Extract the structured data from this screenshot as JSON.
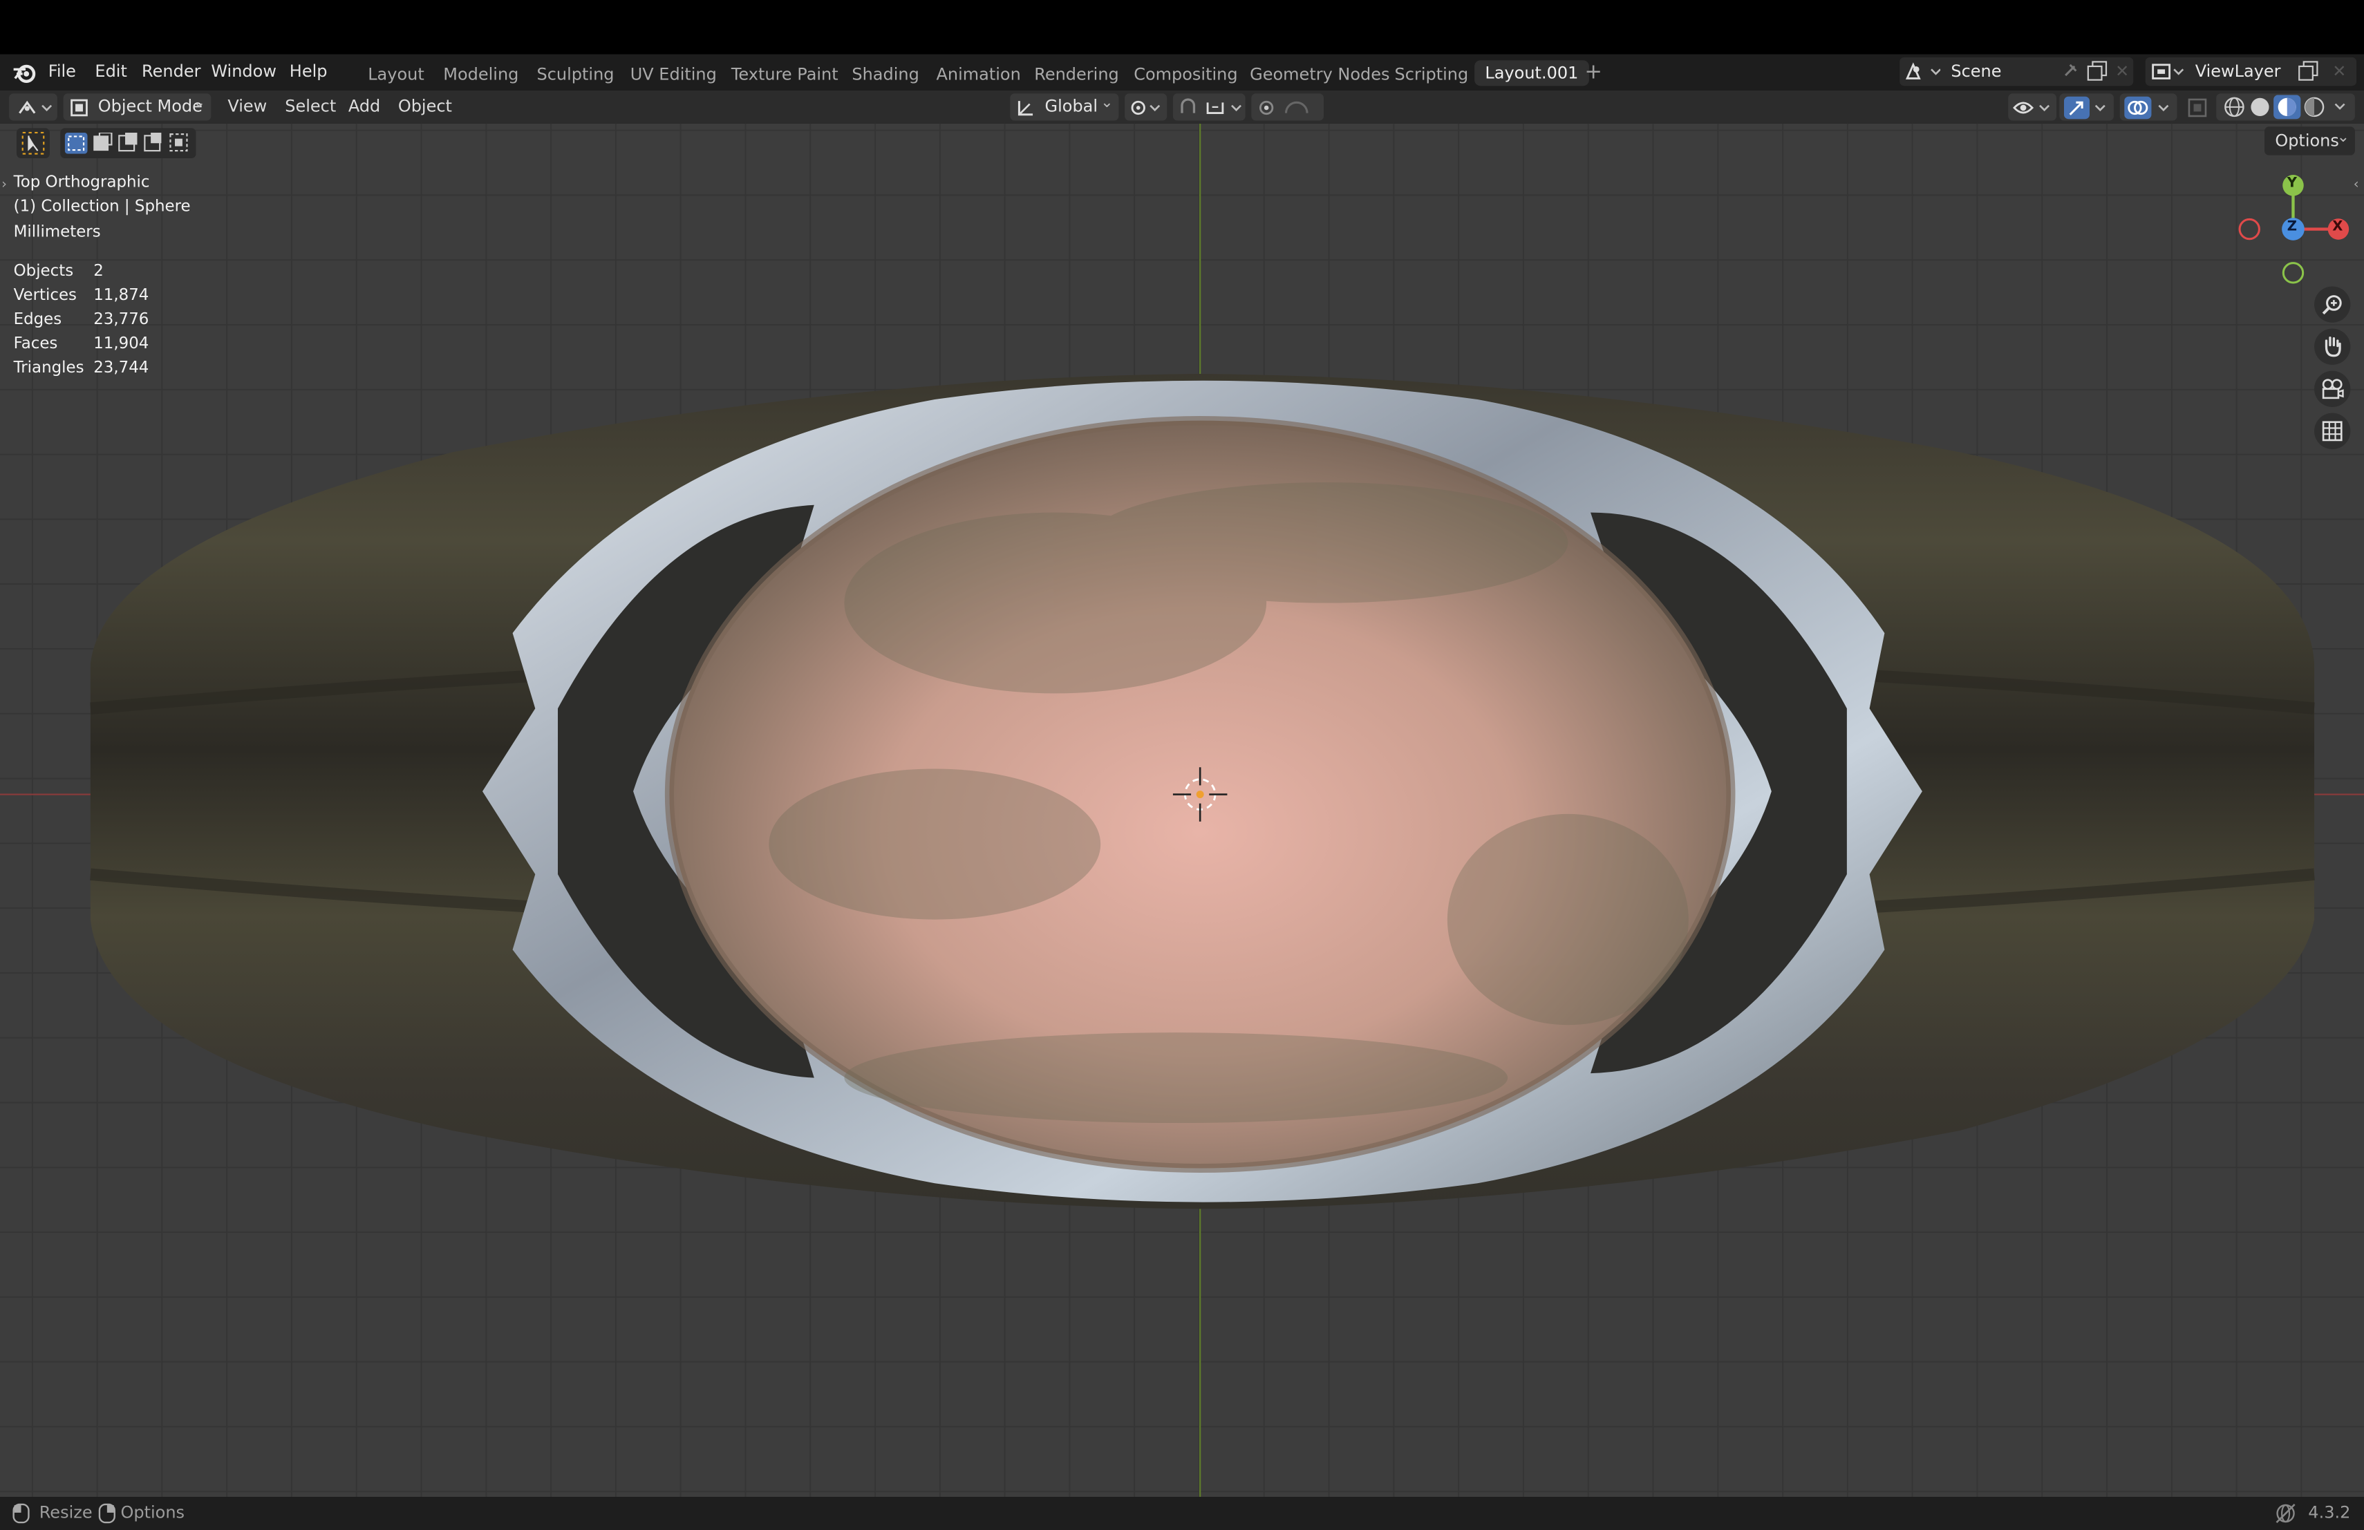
{
  "menubar": {
    "menus": [
      "File",
      "Edit",
      "Render",
      "Window",
      "Help"
    ],
    "workspaces": [
      "Layout",
      "Modeling",
      "Sculpting",
      "UV Editing",
      "Texture Paint",
      "Shading",
      "Animation",
      "Rendering",
      "Compositing",
      "Geometry Nodes",
      "Scripting",
      "Layout.001"
    ],
    "active_workspace": "Layout.001",
    "add_workspace": "+",
    "scene": "Scene",
    "view_layer": "ViewLayer"
  },
  "header": {
    "mode": "Object Mode",
    "menus": [
      "View",
      "Select",
      "Add",
      "Object"
    ],
    "transform_orientation": "Global",
    "options_label": "Options"
  },
  "viewport": {
    "view_name": "Top Orthographic",
    "collection": "(1) Collection | Sphere",
    "units": "Millimeters",
    "stats": [
      {
        "label": "Objects",
        "value": "2"
      },
      {
        "label": "Vertices",
        "value": "11,874"
      },
      {
        "label": "Edges",
        "value": "23,776"
      },
      {
        "label": "Faces",
        "value": "11,904"
      },
      {
        "label": "Triangles",
        "value": "23,744"
      }
    ],
    "gizmo": {
      "y": "Y",
      "x": "X",
      "z": "Z"
    }
  },
  "statusbar": {
    "resize": "Resize",
    "options": "Options",
    "version": "4.3.2"
  },
  "colors": {
    "axis_x": "#e04a4a",
    "axis_y": "#8bc34a",
    "axis_z": "#4a8fe0",
    "accent": "#4772b3"
  },
  "icons": [
    "blender-logo-icon",
    "editor-type-icon",
    "object-mode-icon",
    "transform-orientation-icon",
    "pivot-icon",
    "snap-icon",
    "proportional-edit-icon",
    "visibility-icon",
    "gizmo-icon",
    "overlay-icon",
    "xray-icon",
    "wireframe-shading-icon",
    "solid-shading-icon",
    "material-shading-icon",
    "rendered-shading-icon",
    "zoom-icon",
    "hand-pan-icon",
    "camera-icon",
    "grid-icon",
    "select-box-icon",
    "mouse-icon"
  ]
}
